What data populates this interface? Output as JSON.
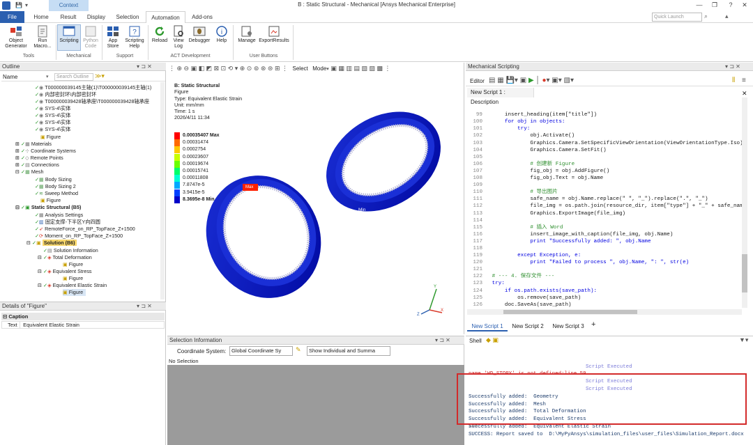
{
  "window": {
    "title": "B : Static Structural - Mechanical [Ansys Mechanical Enterprise]",
    "context_label": "Context"
  },
  "tabs": [
    "File",
    "Home",
    "Result",
    "Display",
    "Selection",
    "Automation",
    "Add-ons"
  ],
  "search": {
    "placeholder": "Quick Launch"
  },
  "ribbon": {
    "buttons": [
      {
        "label": "Object\nGenerator"
      },
      {
        "label": "Run\nMacro..."
      },
      {
        "label": "Scripting"
      },
      {
        "label": "Python\nCode"
      },
      {
        "label": "App\nStore"
      },
      {
        "label": "Scripting\nHelp"
      },
      {
        "label": "Reload"
      },
      {
        "label": "View\nLog"
      },
      {
        "label": "Debugger"
      },
      {
        "label": "Help"
      },
      {
        "label": "Manage"
      },
      {
        "label": "ExportResults"
      }
    ],
    "groups": [
      "Tools",
      "Mechanical",
      "Support",
      "ACT Development",
      "User Buttons"
    ]
  },
  "outline": {
    "title": "Outline",
    "name_col": "Name",
    "search_placeholder": "Search Outline",
    "items": [
      "T000000039145主轴(1)\\T000000039145主轴(1)",
      "内部密封环\\内部密封环",
      "T000000039428轴承座\\T000000039428轴承座",
      "SYS-4\\实体",
      "SYS-4\\实体",
      "SYS-4\\实体",
      "SYS-4\\实体",
      "Figure",
      "Materials",
      "Coordinate Systems",
      "Remote Points",
      "Connections",
      "Mesh",
      "Body Sizing",
      "Body Sizing 2",
      "Sweep Method",
      "Figure",
      "Static Structural (B5)",
      "Analysis Settings",
      "固定支撑-下半区Y向四圆",
      "RemoteForce_on_RP_TopFace_Z+1500",
      "Moment_on_RP_TopFace_Z+1500",
      "Solution (B6)",
      "Solution Information",
      "Total Deformation",
      "Figure",
      "Equivalent Stress",
      "Figure",
      "Equivalent Elastic Strain",
      "Figure"
    ]
  },
  "details": {
    "title": "Details of \"Figure\"",
    "section": "Caption",
    "key": "Text",
    "value": "Equivalent Elastic Strain"
  },
  "viewport": {
    "toolbar_select": "Select",
    "toolbar_mode": "Mode",
    "info_title": "B: Static Structural",
    "info_lines": [
      "Figure",
      "Type: Equivalent Elastic Strain",
      "Unit: mm/mm",
      "Time: 1 s",
      "2026/4/11 11:34"
    ],
    "legend": [
      "0.00035407 Max",
      "0.00031474",
      "0.0002754",
      "0.00023607",
      "0.00019674",
      "0.00015741",
      "0.00011808",
      "7.8747e-5",
      "3.9415e-5",
      "8.3695e-8 Min"
    ],
    "legend_colors": [
      "#ff0000",
      "#ff6a00",
      "#ffc800",
      "#c8ff00",
      "#6aff00",
      "#00ff6a",
      "#00ffd2",
      "#00a8ff",
      "#0040ff",
      "#0000c8"
    ],
    "max_label": "Max",
    "min_label": "Min"
  },
  "selection": {
    "title": "Selection Information",
    "coord_label": "Coordinate System:",
    "coord_value": "Global Coordinate Sy",
    "show_value": "Show Individual and Summa",
    "status": "No Selection"
  },
  "scripting": {
    "title": "Mechanical Scripting",
    "editor_label": "Editor",
    "active_script": "New Script 1 : Description",
    "script_tabs": [
      "New Script 1",
      "New Script 2",
      "New Script 3"
    ],
    "lines": [
      [
        "99",
        "    insert_heading(item[\"title\"])"
      ],
      [
        "100",
        "    for obj in objects:"
      ],
      [
        "101",
        "        try:"
      ],
      [
        "102",
        "            obj.Activate()"
      ],
      [
        "103",
        "            Graphics.Camera.SetSpecificViewOrientation(ViewOrientationType.Iso)"
      ],
      [
        "104",
        "            Graphics.Camera.SetFit()"
      ],
      [
        "105",
        ""
      ],
      [
        "106",
        "            # 创建新 Figure"
      ],
      [
        "107",
        "            fig_obj = obj.AddFigure()"
      ],
      [
        "108",
        "            fig_obj.Text = obj.Name"
      ],
      [
        "109",
        ""
      ],
      [
        "110",
        "            # 导出图片"
      ],
      [
        "111",
        "            safe_name = obj.Name.replace(\" \", \"_\").replace(\".\", \"_\")"
      ],
      [
        "112",
        "            file_img = os.path.join(resource_dir, item[\"type\"] + \"_\" + safe_nam"
      ],
      [
        "113",
        "            Graphics.ExportImage(file_img)"
      ],
      [
        "114",
        ""
      ],
      [
        "115",
        "            # 插入 Word"
      ],
      [
        "116",
        "            insert_image_with_caption(file_img, obj.Name)"
      ],
      [
        "117",
        "            print \"Successfully added: \", obj.Name"
      ],
      [
        "118",
        ""
      ],
      [
        "119",
        "        except Exception, e:"
      ],
      [
        "120",
        "            print \"Failed to process \", obj.Name, \": \", str(e)"
      ],
      [
        "121",
        ""
      ],
      [
        "122",
        "# --- 4. 保存文件 ---"
      ],
      [
        "123",
        "try:"
      ],
      [
        "124",
        "    if os.path.exists(save_path):"
      ],
      [
        "125",
        "        os.remove(save_path)"
      ],
      [
        "126",
        "    doc.SaveAs(save_path)"
      ],
      [
        "127",
        "    print \"SUCCESS: Report saved to \", save_path"
      ],
      [
        "128",
        "except Exception, e:"
      ],
      [
        "129",
        "    print \"SAVE ERROR: \", str(e)"
      ]
    ]
  },
  "shell": {
    "title": "Shell",
    "lines": [
      {
        "t": "Script Executed",
        "c": "exec"
      },
      {
        "t": "name 'WD_STORY' is not defined:line 59",
        "c": "err"
      },
      {
        "t": "Script Executed",
        "c": "exec"
      },
      {
        "t": "Script Executed",
        "c": "exec"
      },
      {
        "t": "Successfully added:  Geometry",
        "c": "ok"
      },
      {
        "t": "Successfully added:  Mesh",
        "c": "ok"
      },
      {
        "t": "Successfully added:  Total Deformation",
        "c": "ok"
      },
      {
        "t": "Successfully added:  Equivalent Stress",
        "c": "ok"
      },
      {
        "t": "Successfully added:  Equivalent Elastic Strain",
        "c": "ok"
      },
      {
        "t": "SUCCESS: Report saved to  D:\\MyPyAnsys\\simulation_files\\user_files\\Simulation_Report.docx",
        "c": "ok"
      }
    ],
    "prompt": ">>>"
  }
}
